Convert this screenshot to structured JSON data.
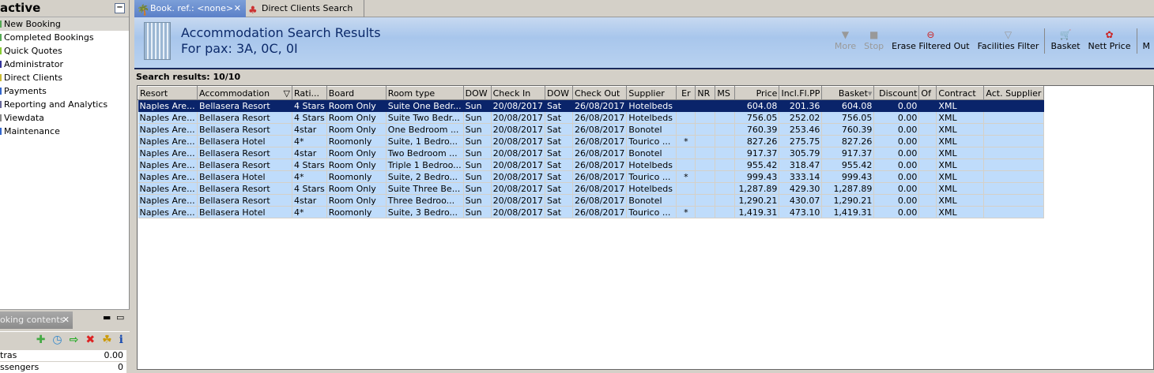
{
  "left_panel": {
    "title": "active",
    "items": [
      {
        "label": "New Booking",
        "selected": true
      },
      {
        "label": "Completed Bookings"
      },
      {
        "label": "Quick Quotes"
      },
      {
        "label": "Administrator"
      },
      {
        "label": "Direct Clients"
      },
      {
        "label": "Payments"
      },
      {
        "label": "Reporting and Analytics"
      },
      {
        "label": "Viewdata"
      },
      {
        "label": "Maintenance"
      }
    ]
  },
  "booking_contents": {
    "tab_label": "oking contents",
    "rows": [
      {
        "label": "tras",
        "value": "0.00"
      },
      {
        "label": "ssengers",
        "value": "0"
      }
    ]
  },
  "tabs": [
    {
      "label": "Book. ref.: <none>",
      "active": true
    },
    {
      "label": "Direct Clients Search"
    }
  ],
  "banner": {
    "title": "Accommodation Search Results",
    "subtitle": "For pax: 3A, 0C, 0I"
  },
  "toolbar": {
    "more": "More",
    "stop": "Stop",
    "erase": "Erase Filtered Out",
    "facilities": "Facilities Filter",
    "basket": "Basket",
    "nett": "Nett Price",
    "cut": "M"
  },
  "search_results_label": "Search results: 10/10",
  "columns": [
    "Resort",
    "Accommodation",
    "Rati...",
    "Board",
    "Room type",
    "DOW",
    "Check In",
    "DOW",
    "Check Out",
    "Supplier",
    "Er",
    "NR",
    "MS",
    "Price",
    "Incl.Fl.PP",
    "Basket",
    "Discount",
    "Of",
    "Contract",
    "Act. Supplier"
  ],
  "rows": [
    [
      "Naples Are...",
      "Bellasera Resort",
      "4 Stars",
      "Room Only",
      "Suite One Bedr...",
      "Sun",
      "20/08/2017",
      "Sat",
      "26/08/2017",
      "Hotelbeds",
      "",
      "",
      "",
      "604.08",
      "201.36",
      "604.08",
      "0.00",
      "",
      "XML",
      ""
    ],
    [
      "Naples Are...",
      "Bellasera Resort",
      "4 Stars",
      "Room Only",
      "Suite Two Bedr...",
      "Sun",
      "20/08/2017",
      "Sat",
      "26/08/2017",
      "Hotelbeds",
      "",
      "",
      "",
      "756.05",
      "252.02",
      "756.05",
      "0.00",
      "",
      "XML",
      ""
    ],
    [
      "Naples Are...",
      "Bellasera Resort",
      "4star",
      "Room Only",
      "One Bedroom ...",
      "Sun",
      "20/08/2017",
      "Sat",
      "26/08/2017",
      "Bonotel",
      "",
      "",
      "",
      "760.39",
      "253.46",
      "760.39",
      "0.00",
      "",
      "XML",
      ""
    ],
    [
      "Naples Are...",
      "Bellasera Hotel",
      "4*",
      "Roomonly",
      "Suite, 1 Bedro...",
      "Sun",
      "20/08/2017",
      "Sat",
      "26/08/2017",
      "Tourico ...",
      "*",
      "",
      "",
      "827.26",
      "275.75",
      "827.26",
      "0.00",
      "",
      "XML",
      ""
    ],
    [
      "Naples Are...",
      "Bellasera Resort",
      "4star",
      "Room Only",
      "Two Bedroom ...",
      "Sun",
      "20/08/2017",
      "Sat",
      "26/08/2017",
      "Bonotel",
      "",
      "",
      "",
      "917.37",
      "305.79",
      "917.37",
      "0.00",
      "",
      "XML",
      ""
    ],
    [
      "Naples Are...",
      "Bellasera Resort",
      "4 Stars",
      "Room Only",
      "Triple 1 Bedroo...",
      "Sun",
      "20/08/2017",
      "Sat",
      "26/08/2017",
      "Hotelbeds",
      "",
      "",
      "",
      "955.42",
      "318.47",
      "955.42",
      "0.00",
      "",
      "XML",
      ""
    ],
    [
      "Naples Are...",
      "Bellasera Hotel",
      "4*",
      "Roomonly",
      "Suite, 2 Bedro...",
      "Sun",
      "20/08/2017",
      "Sat",
      "26/08/2017",
      "Tourico ...",
      "*",
      "",
      "",
      "999.43",
      "333.14",
      "999.43",
      "0.00",
      "",
      "XML",
      ""
    ],
    [
      "Naples Are...",
      "Bellasera Resort",
      "4 Stars",
      "Room Only",
      "Suite Three Be...",
      "Sun",
      "20/08/2017",
      "Sat",
      "26/08/2017",
      "Hotelbeds",
      "",
      "",
      "",
      "1,287.89",
      "429.30",
      "1,287.89",
      "0.00",
      "",
      "XML",
      ""
    ],
    [
      "Naples Are...",
      "Bellasera Resort",
      "4star",
      "Room Only",
      "Three Bedroo...",
      "Sun",
      "20/08/2017",
      "Sat",
      "26/08/2017",
      "Bonotel",
      "",
      "",
      "",
      "1,290.21",
      "430.07",
      "1,290.21",
      "0.00",
      "",
      "XML",
      ""
    ],
    [
      "Naples Are...",
      "Bellasera Hotel",
      "4*",
      "Roomonly",
      "Suite, 3 Bedro...",
      "Sun",
      "20/08/2017",
      "Sat",
      "26/08/2017",
      "Tourico ...",
      "*",
      "",
      "",
      "1,419.31",
      "473.10",
      "1,419.31",
      "0.00",
      "",
      "XML",
      ""
    ]
  ]
}
